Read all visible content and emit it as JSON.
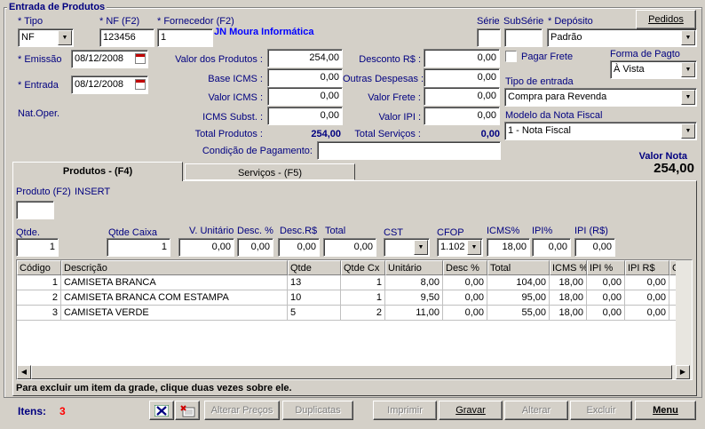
{
  "window": {
    "title": "Entrada de Produtos"
  },
  "header": {
    "tipo": {
      "label": "* Tipo",
      "value": "NF"
    },
    "nf": {
      "label": "* NF (F2)",
      "value": "123456"
    },
    "fornecedor": {
      "label": "* Fornecedor (F2)",
      "value": "1",
      "name": "JN Moura Informática"
    },
    "serie": {
      "label": "Série",
      "value": ""
    },
    "subserie": {
      "label": "SubSérie",
      "value": ""
    },
    "deposito": {
      "label": "* Depósito",
      "value": "Padrão"
    },
    "pedidos_label": "Pedidos",
    "emissao": {
      "label": "* Emissão",
      "value": "08/12/2008"
    },
    "entrada": {
      "label": "* Entrada",
      "value": "08/12/2008"
    },
    "nat_oper_label": "Nat.Oper.",
    "pagar_frete_label": "Pagar Frete",
    "pagar_frete_checked": false,
    "forma_pagto": {
      "label": "Forma de Pagto",
      "value": "À Vista"
    },
    "tipo_entrada": {
      "label": "Tipo de entrada",
      "value": "Compra para Revenda"
    },
    "modelo_nf": {
      "label": "Modelo da Nota Fiscal",
      "value": "1 - Nota Fiscal"
    }
  },
  "totals": {
    "valor_produtos": {
      "label": "Valor dos Produtos :",
      "value": "254,00"
    },
    "base_icms": {
      "label": "Base ICMS :",
      "value": "0,00"
    },
    "valor_icms": {
      "label": "Valor ICMS :",
      "value": "0,00"
    },
    "icms_subst": {
      "label": "ICMS Subst. :",
      "value": "0,00"
    },
    "total_produtos": {
      "label": "Total Produtos :",
      "value": "254,00"
    },
    "desconto": {
      "label": "Desconto R$ :",
      "value": "0,00"
    },
    "outras_despesas": {
      "label": "Outras Despesas :",
      "value": "0,00"
    },
    "valor_frete": {
      "label": "Valor Frete :",
      "value": "0,00"
    },
    "valor_ipi": {
      "label": "Valor IPI :",
      "value": "0,00"
    },
    "total_servicos": {
      "label": "Total Serviços :",
      "value": "0,00"
    },
    "condicao_pagamento": {
      "label": "Condição de Pagamento:",
      "value": ""
    },
    "valor_nota": {
      "label": "Valor Nota",
      "value": "254,00"
    }
  },
  "tabs": [
    {
      "label": "Produtos  -  (F4)",
      "active": true
    },
    {
      "label": "Serviços  -  (F5)",
      "active": false
    }
  ],
  "item_entry": {
    "produto_label": "Produto (F2)",
    "mode": "INSERT",
    "produto_value": "",
    "qtde": {
      "label": "Qtde.",
      "value": "1"
    },
    "qtde_caixa": {
      "label": "Qtde Caixa",
      "value": "1"
    },
    "v_unitario": {
      "label": "V. Unitário",
      "value": "0,00"
    },
    "desc_pct": {
      "label": "Desc. %",
      "value": "0,00"
    },
    "desc_rs": {
      "label": "Desc.R$",
      "value": "0,00"
    },
    "total": {
      "label": "Total",
      "value": "0,00"
    },
    "cst": {
      "label": "CST",
      "value": ""
    },
    "cfop": {
      "label": "CFOP",
      "value": "1.102"
    },
    "icms_pct": {
      "label": "ICMS%",
      "value": "18,00"
    },
    "ipi_pct": {
      "label": "IPI%",
      "value": "0,00"
    },
    "ipi_rs": {
      "label": "IPI (R$)",
      "value": "0,00"
    }
  },
  "grid": {
    "columns": [
      "Código",
      "Descrição",
      "Qtde",
      "Qtde Cx",
      "Unitário",
      "Desc %",
      "Total",
      "ICMS %",
      "IPI %",
      "IPI R$",
      "Cus"
    ],
    "rows": [
      [
        "1",
        "CAMISETA BRANCA",
        "13",
        "1",
        "8,00",
        "0,00",
        "104,00",
        "18,00",
        "0,00",
        "0,00",
        ""
      ],
      [
        "2",
        "CAMISETA BRANCA COM ESTAMPA",
        "10",
        "1",
        "9,50",
        "0,00",
        "95,00",
        "18,00",
        "0,00",
        "0,00",
        ""
      ],
      [
        "3",
        "CAMISETA VERDE",
        "5",
        "2",
        "11,00",
        "0,00",
        "55,00",
        "18,00",
        "0,00",
        "0,00",
        ""
      ]
    ]
  },
  "hint": "Para excluir um item da grade, clique duas vezes sobre ele.",
  "footer": {
    "itens_label": "Itens:",
    "itens_count": "3",
    "buttons": {
      "alterar_precos": "Alterar Preços",
      "duplicatas": "Duplicatas",
      "imprimir": "Imprimir",
      "gravar": "Gravar",
      "alterar": "Alterar",
      "excluir": "Excluir",
      "menu": "Menu"
    }
  },
  "colors": {
    "label_navy": "#000080",
    "count_red": "#ff0000",
    "face": "#d4d0c8"
  }
}
